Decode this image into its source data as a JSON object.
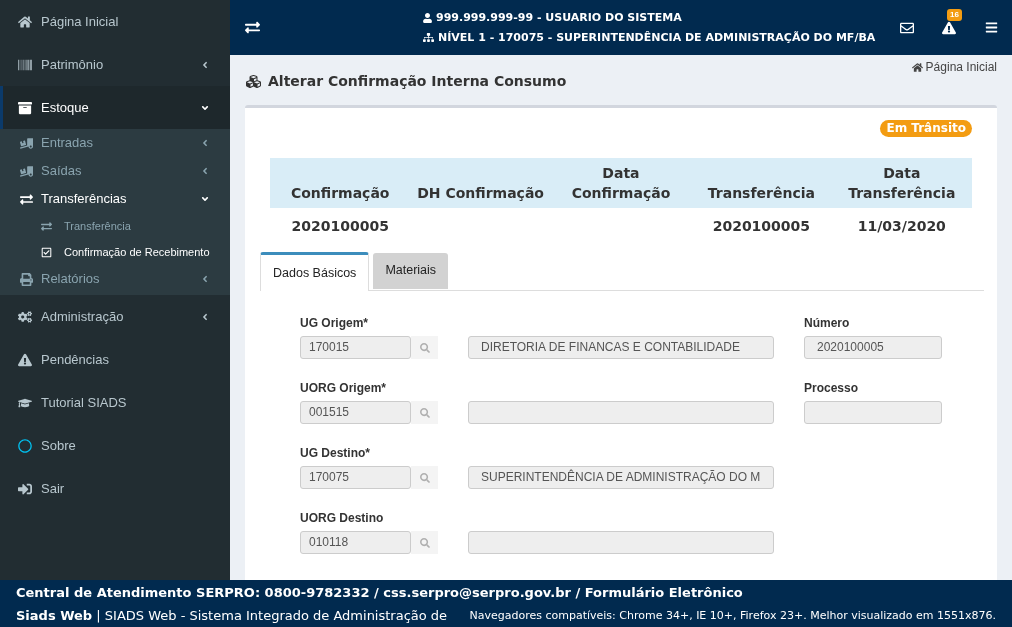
{
  "sidebar": {
    "items": [
      {
        "label": "Página Inicial",
        "kind": "link",
        "selected": false
      },
      {
        "label": "Patrimônio",
        "kind": "menu",
        "expanded": false,
        "selected": false
      },
      {
        "label": "Estoque",
        "kind": "menu",
        "expanded": true,
        "selected": true,
        "children": [
          {
            "label": "Entradas",
            "kind": "menu",
            "expanded": false,
            "selected": false
          },
          {
            "label": "Saídas",
            "kind": "menu",
            "expanded": false,
            "selected": false
          },
          {
            "label": "Transferências",
            "kind": "menu",
            "expanded": true,
            "selected": true,
            "children": [
              {
                "label": "Transferência",
                "selected": false
              },
              {
                "label": "Confirmação de Recebimento",
                "selected": true
              }
            ]
          },
          {
            "label": "Relatórios",
            "kind": "menu",
            "expanded": false,
            "selected": false
          }
        ]
      },
      {
        "label": "Administração",
        "kind": "menu",
        "expanded": false,
        "selected": false
      },
      {
        "label": "Pendências",
        "kind": "link",
        "selected": false
      },
      {
        "label": "Tutorial SIADS",
        "kind": "link",
        "selected": false
      },
      {
        "label": "Sobre",
        "kind": "link",
        "selected": false
      },
      {
        "label": "Sair",
        "kind": "link",
        "selected": false
      }
    ]
  },
  "header": {
    "user": "999.999.999-99 - USUARIO DO SISTEMA",
    "unit": "NÍVEL 1 - 170075 - SUPERINTENDÊNCIA DE ADMINISTRAÇÃO DO MF/BA",
    "alerts_badge": "16"
  },
  "page": {
    "title": "Alterar Confirmação Interna Consumo",
    "breadcrumb": "Página Inicial",
    "status_badge": "Em Trânsito"
  },
  "summary_table": {
    "columns": [
      "Confirmação",
      "DH Confirmação",
      "Data Confirmação",
      "Transferência",
      "Data Transferência"
    ],
    "rows": [
      [
        "2020100005",
        null,
        null,
        "2020100005",
        "11/03/2020"
      ]
    ]
  },
  "tabs": [
    {
      "label": "Dados Básicos",
      "selected": true
    },
    {
      "label": "Materiais",
      "selected": false
    }
  ],
  "form": {
    "rows": [
      {
        "label": "UG Origem*",
        "code": "170015",
        "description": "DIRETORIA DE FINANCAS E CONTABILIDADE",
        "side": {
          "label": "Número",
          "value": "2020100005"
        }
      },
      {
        "label": "UORG Origem*",
        "code": "001515",
        "side": {
          "label": "Processo"
        }
      },
      {
        "label": "UG Destino*",
        "code": "170075",
        "description": "SUPERINTENDÊNCIA DE ADMINISTRAÇÃO DO M"
      },
      {
        "label": "UORG Destino",
        "code": "010118"
      }
    ]
  },
  "footer": {
    "contact": "Central de Atendimento SERPRO: 0800-9782332 / css.serpro@serpro.gov.br / Formulário Eletrônico",
    "system": "**Siads Web** | SIADS Web - Sistema Integrado de Administração de",
    "browsers": "Navegadores compatíveis: Chrome 34+, IE 10+, Firefox 23+. Melhor visualizado em 1551x876."
  }
}
